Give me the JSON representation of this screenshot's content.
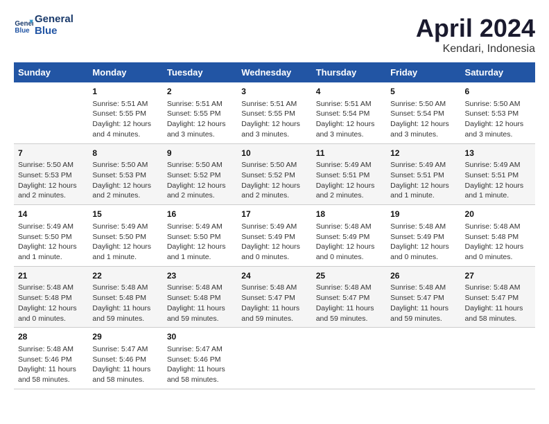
{
  "header": {
    "logo_line1": "General",
    "logo_line2": "Blue",
    "month": "April 2024",
    "location": "Kendari, Indonesia"
  },
  "days_of_week": [
    "Sunday",
    "Monday",
    "Tuesday",
    "Wednesday",
    "Thursday",
    "Friday",
    "Saturday"
  ],
  "weeks": [
    [
      {
        "day": "",
        "content": ""
      },
      {
        "day": "1",
        "content": "Sunrise: 5:51 AM\nSunset: 5:55 PM\nDaylight: 12 hours\nand 4 minutes."
      },
      {
        "day": "2",
        "content": "Sunrise: 5:51 AM\nSunset: 5:55 PM\nDaylight: 12 hours\nand 3 minutes."
      },
      {
        "day": "3",
        "content": "Sunrise: 5:51 AM\nSunset: 5:55 PM\nDaylight: 12 hours\nand 3 minutes."
      },
      {
        "day": "4",
        "content": "Sunrise: 5:51 AM\nSunset: 5:54 PM\nDaylight: 12 hours\nand 3 minutes."
      },
      {
        "day": "5",
        "content": "Sunrise: 5:50 AM\nSunset: 5:54 PM\nDaylight: 12 hours\nand 3 minutes."
      },
      {
        "day": "6",
        "content": "Sunrise: 5:50 AM\nSunset: 5:53 PM\nDaylight: 12 hours\nand 3 minutes."
      }
    ],
    [
      {
        "day": "7",
        "content": "Sunrise: 5:50 AM\nSunset: 5:53 PM\nDaylight: 12 hours\nand 2 minutes."
      },
      {
        "day": "8",
        "content": "Sunrise: 5:50 AM\nSunset: 5:53 PM\nDaylight: 12 hours\nand 2 minutes."
      },
      {
        "day": "9",
        "content": "Sunrise: 5:50 AM\nSunset: 5:52 PM\nDaylight: 12 hours\nand 2 minutes."
      },
      {
        "day": "10",
        "content": "Sunrise: 5:50 AM\nSunset: 5:52 PM\nDaylight: 12 hours\nand 2 minutes."
      },
      {
        "day": "11",
        "content": "Sunrise: 5:49 AM\nSunset: 5:51 PM\nDaylight: 12 hours\nand 2 minutes."
      },
      {
        "day": "12",
        "content": "Sunrise: 5:49 AM\nSunset: 5:51 PM\nDaylight: 12 hours\nand 1 minute."
      },
      {
        "day": "13",
        "content": "Sunrise: 5:49 AM\nSunset: 5:51 PM\nDaylight: 12 hours\nand 1 minute."
      }
    ],
    [
      {
        "day": "14",
        "content": "Sunrise: 5:49 AM\nSunset: 5:50 PM\nDaylight: 12 hours\nand 1 minute."
      },
      {
        "day": "15",
        "content": "Sunrise: 5:49 AM\nSunset: 5:50 PM\nDaylight: 12 hours\nand 1 minute."
      },
      {
        "day": "16",
        "content": "Sunrise: 5:49 AM\nSunset: 5:50 PM\nDaylight: 12 hours\nand 1 minute."
      },
      {
        "day": "17",
        "content": "Sunrise: 5:49 AM\nSunset: 5:49 PM\nDaylight: 12 hours\nand 0 minutes."
      },
      {
        "day": "18",
        "content": "Sunrise: 5:48 AM\nSunset: 5:49 PM\nDaylight: 12 hours\nand 0 minutes."
      },
      {
        "day": "19",
        "content": "Sunrise: 5:48 AM\nSunset: 5:49 PM\nDaylight: 12 hours\nand 0 minutes."
      },
      {
        "day": "20",
        "content": "Sunrise: 5:48 AM\nSunset: 5:48 PM\nDaylight: 12 hours\nand 0 minutes."
      }
    ],
    [
      {
        "day": "21",
        "content": "Sunrise: 5:48 AM\nSunset: 5:48 PM\nDaylight: 12 hours\nand 0 minutes."
      },
      {
        "day": "22",
        "content": "Sunrise: 5:48 AM\nSunset: 5:48 PM\nDaylight: 11 hours\nand 59 minutes."
      },
      {
        "day": "23",
        "content": "Sunrise: 5:48 AM\nSunset: 5:48 PM\nDaylight: 11 hours\nand 59 minutes."
      },
      {
        "day": "24",
        "content": "Sunrise: 5:48 AM\nSunset: 5:47 PM\nDaylight: 11 hours\nand 59 minutes."
      },
      {
        "day": "25",
        "content": "Sunrise: 5:48 AM\nSunset: 5:47 PM\nDaylight: 11 hours\nand 59 minutes."
      },
      {
        "day": "26",
        "content": "Sunrise: 5:48 AM\nSunset: 5:47 PM\nDaylight: 11 hours\nand 59 minutes."
      },
      {
        "day": "27",
        "content": "Sunrise: 5:48 AM\nSunset: 5:47 PM\nDaylight: 11 hours\nand 58 minutes."
      }
    ],
    [
      {
        "day": "28",
        "content": "Sunrise: 5:48 AM\nSunset: 5:46 PM\nDaylight: 11 hours\nand 58 minutes."
      },
      {
        "day": "29",
        "content": "Sunrise: 5:47 AM\nSunset: 5:46 PM\nDaylight: 11 hours\nand 58 minutes."
      },
      {
        "day": "30",
        "content": "Sunrise: 5:47 AM\nSunset: 5:46 PM\nDaylight: 11 hours\nand 58 minutes."
      },
      {
        "day": "",
        "content": ""
      },
      {
        "day": "",
        "content": ""
      },
      {
        "day": "",
        "content": ""
      },
      {
        "day": "",
        "content": ""
      }
    ]
  ]
}
